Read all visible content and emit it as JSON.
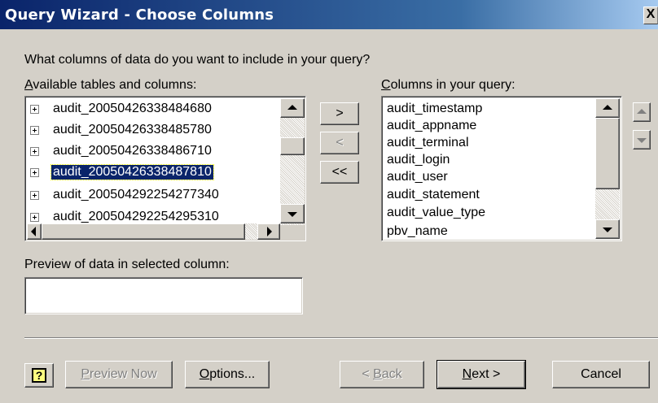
{
  "window": {
    "title": "Query Wizard - Choose Columns",
    "close_glyph": "X"
  },
  "prompt": "What columns of data do you want to include in your query?",
  "available": {
    "label_first": "A",
    "label_rest": "vailable tables and columns:",
    "items": [
      {
        "label": "audit_20050426338484680"
      },
      {
        "label": "audit_20050426338485780"
      },
      {
        "label": "audit_20050426338486710"
      },
      {
        "label": "audit_20050426338487810"
      },
      {
        "label": "audit_200504292254277340"
      },
      {
        "label": "audit_200504292254295310"
      }
    ],
    "selected_index": 3
  },
  "move_buttons": {
    "add": ">",
    "remove": "<",
    "remove_all": "<<"
  },
  "query_columns": {
    "label_first": "C",
    "label_rest": "olumns in your query:",
    "items": [
      "audit_timestamp",
      "audit_appname",
      "audit_terminal",
      "audit_login",
      "audit_user",
      "audit_statement",
      "audit_value_type",
      "pbv_name"
    ]
  },
  "preview": {
    "label": "Preview of data in selected column:",
    "value": ""
  },
  "footer": {
    "help_glyph": "?",
    "preview_now_first": "P",
    "preview_now_rest": "review Now",
    "options_first": "O",
    "options_rest": "ptions...",
    "back_prefix": "< ",
    "back_first": "B",
    "back_rest": "ack",
    "next_first": "N",
    "next_rest": "ext >",
    "cancel": "Cancel"
  },
  "colors": {
    "selection": "#0a246a",
    "face": "#d4d0c8"
  }
}
